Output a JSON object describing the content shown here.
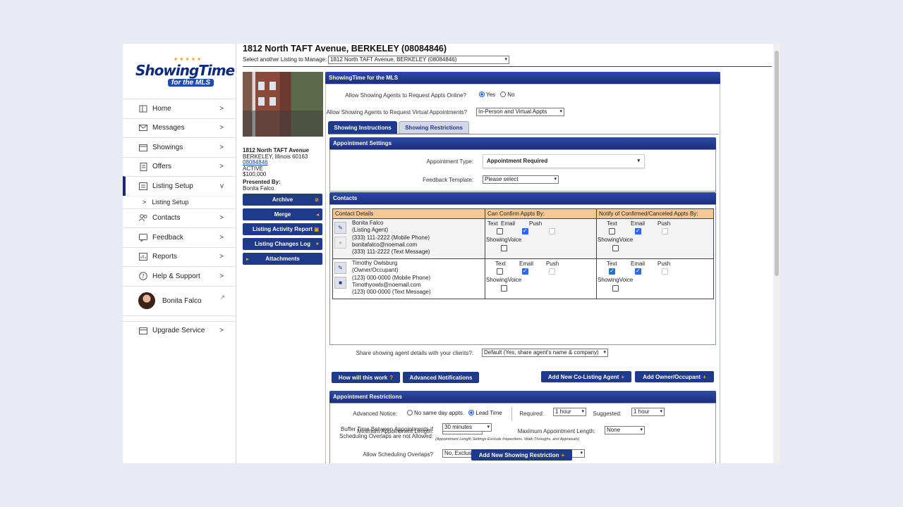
{
  "nav": {
    "logo_main": "ShowingTime",
    "logo_sub": "for the MLS",
    "items": [
      {
        "label": "Home",
        "icon": "home-icon"
      },
      {
        "label": "Messages",
        "icon": "mail-icon"
      },
      {
        "label": "Showings",
        "icon": "calendar-icon"
      },
      {
        "label": "Offers",
        "icon": "offer-icon"
      },
      {
        "label": "Listing Setup",
        "icon": "listing-icon"
      },
      {
        "label": "Listing Setup",
        "icon": "caret-icon"
      },
      {
        "label": "Contacts",
        "icon": "contacts-icon"
      },
      {
        "label": "Feedback",
        "icon": "feedback-icon"
      },
      {
        "label": "Reports",
        "icon": "reports-icon"
      },
      {
        "label": "Help & Support",
        "icon": "help-icon"
      },
      {
        "label": "Bonita Falco",
        "icon": "avatar"
      },
      {
        "label": "Upgrade Service",
        "icon": "upgrade-icon"
      }
    ],
    "chev": ">",
    "chev_open": "v",
    "sub_glyph": ">"
  },
  "header": {
    "title": "1812 North TAFT Avenue, BERKELEY (08084846)",
    "select_label": "Select another Listing to Manage:",
    "select_value": "1812 North TAFT Avenue, BERKELEY (08084846)"
  },
  "listing": {
    "address": "1812 North TAFT Avenue",
    "city": "BERKELEY, Illinois 60163",
    "mls": "08084846",
    "status": "ACTIVE",
    "price": "$100,000",
    "presented_by_label": "Presented By:",
    "presented_by": "Bonita Falco"
  },
  "side_buttons": [
    "Archive",
    "Merge",
    "Listing Activity Report",
    "Listing Changes Log",
    "Attachments"
  ],
  "panel": {
    "title": "ShowingTime for the MLS",
    "allow_online_label": "Allow Showing Agents to Request Appts Online?",
    "yes": "Yes",
    "no": "No",
    "allow_virtual_label": "Allow Showing Agents to Request Virtual Appointments?",
    "virtual_value": "In-Person and Virtual Appts",
    "tabs": [
      "Showing Instructions",
      "Showing Restrictions"
    ]
  },
  "appt_settings": {
    "title": "Appointment Settings",
    "type_label": "Appointment Type:",
    "type_value": "Appointment Required",
    "feedback_label": "Feedback Template:",
    "feedback_value": "Please select"
  },
  "contacts": {
    "title": "Contacts",
    "headers": [
      "Contact Details",
      "Can Confirm Appts By:",
      "Notify of Confirmed/Canceled Appts By:"
    ],
    "method_labels": [
      "Text",
      "Email",
      "Push",
      "ShowingVoice"
    ],
    "rows": [
      {
        "lines": [
          "Bonita Falco",
          "(Listing Agent)",
          "(333) 111-2222 (Mobile Phone)",
          "bonitafalco@noemail.com",
          "(333) 111-2222 (Text Message)"
        ],
        "confirm": {
          "text": false,
          "email": true,
          "push": "disabled",
          "voice": false
        },
        "notify": {
          "text": false,
          "email": true,
          "push": "disabled",
          "voice": false
        }
      },
      {
        "lines": [
          "Timothy Owlsburg",
          "(Owner/Occupant)",
          "(123) 000-0000 (Mobile Phone)",
          "Timothyowls@noemail.com",
          "(123) 000-0000 (Text Message)"
        ],
        "confirm": {
          "text": false,
          "email": true,
          "push": "disabled",
          "voice": false
        },
        "notify": {
          "text": true,
          "email": true,
          "push": "disabled",
          "voice": false
        }
      }
    ],
    "share_label": "Share showing agent details with your clients?:",
    "share_value": "Default (Yes, share agent's name & company)",
    "btn_how": "How will this work",
    "btn_adv": "Advanced Notifications",
    "btn_colist": "Add New Co-Listing Agent",
    "btn_owner": "Add Owner/Occupant"
  },
  "restrictions": {
    "title": "Appointment Restrictions",
    "adv_notice_label": "Advanced Notice:",
    "no_same_day": "No same day appts.",
    "lead_time": "Lead Time",
    "required_label": "Required:",
    "required_value": "1 hour",
    "suggested_label": "Suggested:",
    "suggested_value": "1 hour",
    "min_len_label": "Minimum Appointment Length:",
    "min_len_value": "None",
    "max_len_label": "Maximum Appointment Length:",
    "max_len_value": "None",
    "len_note": "(Appointment Length Settings Exclude Inspections, Walk-Throughs, and Appraisals)",
    "overlap_label": "Allow Scheduling Overlaps?",
    "overlap_value": "No, Exclusive appointment requests only",
    "buffer_label_1": "Buffer Time Between Appointments if",
    "buffer_label_2": "Scheduling Overlaps are not Allowed:",
    "buffer_value": "30 minutes",
    "add_btn": "Add New Showing Restriction"
  }
}
